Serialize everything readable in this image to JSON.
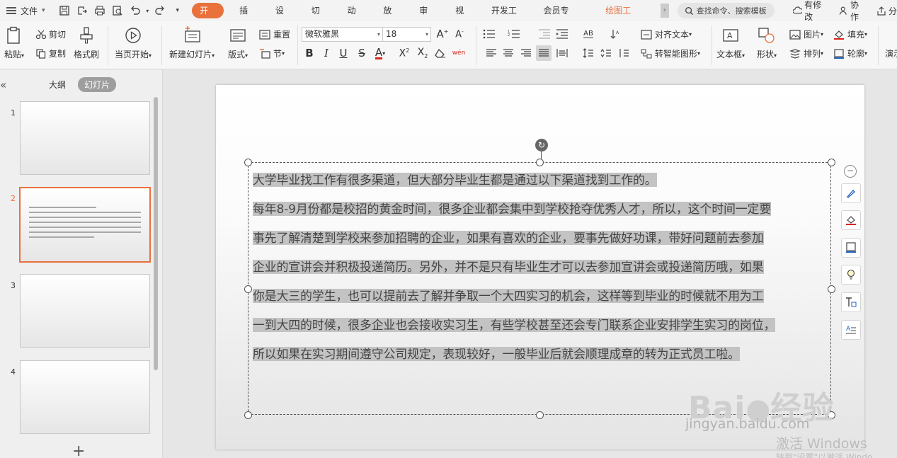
{
  "menubar": {
    "file_label": "文件",
    "tabs": [
      {
        "label": "开始",
        "active": true
      },
      {
        "label": "插入"
      },
      {
        "label": "设计"
      },
      {
        "label": "切换"
      },
      {
        "label": "动画"
      },
      {
        "label": "放映"
      },
      {
        "label": "审阅"
      },
      {
        "label": "视图"
      },
      {
        "label": "开发工具"
      },
      {
        "label": "会员专享"
      },
      {
        "label": "绘图工具",
        "highlight": true
      }
    ],
    "search_placeholder": "查找命令、搜索模板",
    "right": {
      "modified": "有修改",
      "collab": "协作",
      "share": "分"
    }
  },
  "ribbon": {
    "paste": "粘贴",
    "cut": "剪切",
    "copy": "复制",
    "format_painter": "格式刷",
    "play_from_current": "当页开始",
    "new_slide": "新建幻灯片",
    "layout": "版式",
    "reset": "重置",
    "section": "节",
    "font_name": "微软雅黑",
    "font_size": "18",
    "align_text": "对齐文本",
    "smartart": "转智能图形",
    "textbox": "文本框",
    "shape": "形状",
    "picture": "图片",
    "fill": "填充",
    "arrange": "排列",
    "outline": "轮廓",
    "present": "演示"
  },
  "left_panel": {
    "tab_outline": "大纲",
    "tab_slides": "幻灯片",
    "slide_numbers": [
      "1",
      "2",
      "3",
      "4"
    ],
    "add_slide": "+"
  },
  "slide": {
    "paragraphs": [
      "大学毕业找工作有很多渠道，但大部分毕业生都是通过以下渠道找到工作的。",
      "每年8-9月份都是校招的黄金时间，很多企业都会集中到学校抢夺优秀人才，所以，这个时间一定要事先了解清楚到学校来参加招聘的企业，如果有喜欢的企业，要事先做好功课，带好问题前去参加企业的宣讲会并积极投递简历。另外，并不是只有毕业生才可以去参加宣讲会或投递简历哦，如果你是大三的学生，也可以提前去了解并争取一个大四实习的机会，这样等到毕业的时候就不用为工一到大四的时候，很多企业也会接收实习生，有些学校甚至还会专门联系企业安排学生实习的岗位，所以如果在实习期间遵守公司规定，表现较好，一般毕业后就会顺理成章的转为正式员工啦。"
    ],
    "lines": [
      "大学毕业找工作有很多渠道，但大部分毕业生都是通过以下渠道找到工作的。",
      "每年8-9月份都是校招的黄金时间，很多企业都会集中到学校抢夺优秀人才，所以，这个时间一定要",
      "事先了解清楚到学校来参加招聘的企业，如果有喜欢的企业，要事先做好功课，带好问题前去参加",
      "企业的宣讲会并积极投递简历。另外，并不是只有毕业生才可以去参加宣讲会或投递简历哦，如果",
      "你是大三的学生，也可以提前去了解并争取一个大四实习的机会，这样等到毕业的时候就不用为工",
      "一到大四的时候，很多企业也会接收实习生，有些学校甚至还会专门联系企业安排学生实习的岗位，",
      "所以如果在实习期间遵守公司规定，表现较好，一般毕业后就会顺理成章的转为正式员工啦。"
    ]
  },
  "watermark": {
    "brand": "Bai",
    "brand2": "经验",
    "url": "jingyan.baidu.com",
    "activate": "激活 Windows",
    "activate_sub": "转到\"设置\"以激活 Windo"
  },
  "colors": {
    "accent": "#e8713c",
    "selection": "#c3c3c3"
  }
}
